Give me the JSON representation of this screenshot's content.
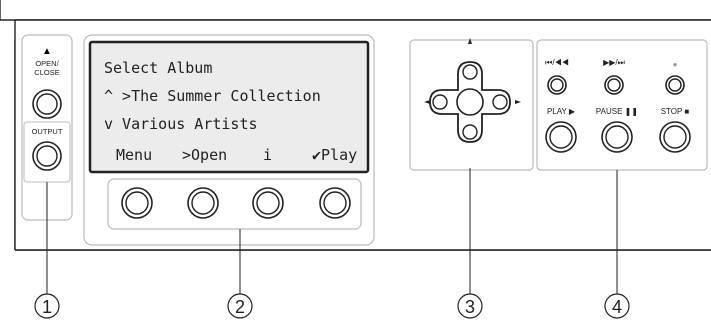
{
  "left_panel": {
    "eject_symbol": "▲",
    "open_close_line1": "OPEN/",
    "open_close_line2": "CLOSE",
    "output_label": "OUTPUT"
  },
  "lcd": {
    "line1": "Select Album",
    "line2": "^ >The Summer Collection",
    "line3": "v  Various Artists",
    "softkey1": "Menu",
    "softkey2": ">Open",
    "softkey3": "i",
    "softkey4": "✔Play"
  },
  "transport": {
    "prev_label": "⏮/◀◀",
    "next_label": "▶▶/⏭",
    "record_dot": "●",
    "play_label": "PLAY ▶",
    "pause_label": "PAUSE ❚❚",
    "stop_label": "STOP ■"
  },
  "callouts": [
    "1",
    "2",
    "3",
    "4"
  ],
  "colors": {
    "panel_bg": "#ffffff",
    "lcd_bg": "#ececec",
    "line": "#222222",
    "panel_edge": "#bbbbbb"
  }
}
